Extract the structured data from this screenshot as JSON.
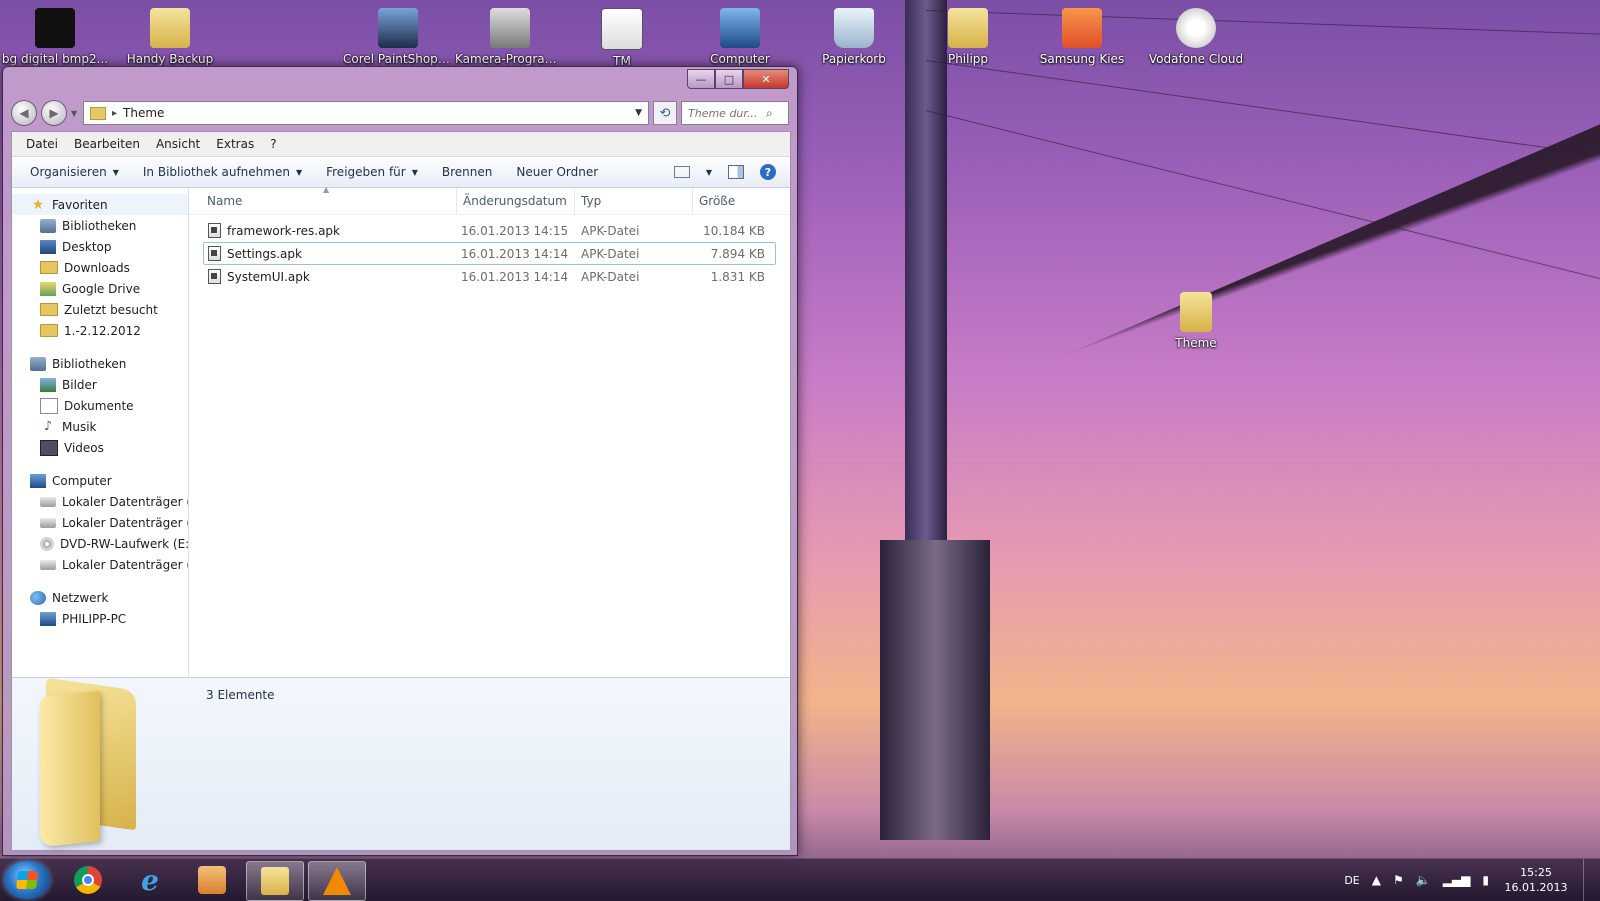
{
  "desktop": {
    "icons": [
      {
        "label": "bg digital bmp2...",
        "icon": "black-image-icon"
      },
      {
        "label": "Handy Backup",
        "icon": "backup-folder-icon"
      },
      {
        "label": "Corel PaintShop Pro",
        "icon": "camera-icon"
      },
      {
        "label": "Kamera-Programme",
        "icon": "camera-icon"
      },
      {
        "label": "TM",
        "icon": "app-icon"
      },
      {
        "label": "Computer",
        "icon": "computer-icon"
      },
      {
        "label": "Papierkorb",
        "icon": "recycle-bin-icon"
      },
      {
        "label": "Philipp",
        "icon": "user-folder-icon"
      },
      {
        "label": "Samsung Kies",
        "icon": "kies-icon"
      },
      {
        "label": "Vodafone Cloud",
        "icon": "cloud-icon"
      }
    ],
    "theme_icon": {
      "label": "Theme",
      "icon": "folder-icon"
    }
  },
  "window": {
    "caption_buttons": {
      "minimize": "—",
      "maximize": "□",
      "close": "✕"
    },
    "address": {
      "path": "Theme",
      "separator": "▸"
    },
    "search_placeholder": "Theme dur...",
    "menu": [
      "Datei",
      "Bearbeiten",
      "Ansicht",
      "Extras",
      "?"
    ],
    "commands": [
      "Organisieren",
      "In Bibliothek aufnehmen",
      "Freigeben für",
      "Brennen",
      "Neuer Ordner"
    ],
    "help_label": "?",
    "nav": {
      "favorites": {
        "label": "Favoriten",
        "items": [
          "Bibliotheken",
          "Desktop",
          "Downloads",
          "Google Drive",
          "Zuletzt besucht",
          "1.-2.12.2012"
        ]
      },
      "libraries": {
        "label": "Bibliotheken",
        "items": [
          "Bilder",
          "Dokumente",
          "Musik",
          "Videos"
        ]
      },
      "computer": {
        "label": "Computer",
        "items": [
          "Lokaler Datenträger (C:)",
          "Lokaler Datenträger (D:)",
          "DVD-RW-Laufwerk (E:) L",
          "Lokaler Datenträger (Q:)"
        ]
      },
      "network": {
        "label": "Netzwerk",
        "items": [
          "PHILIPP-PC"
        ]
      }
    },
    "columns": {
      "name": "Name",
      "date": "Änderungsdatum",
      "type": "Typ",
      "size": "Größe"
    },
    "files": [
      {
        "name": "framework-res.apk",
        "date": "16.01.2013 14:15",
        "type": "APK-Datei",
        "size": "10.184 KB"
      },
      {
        "name": "Settings.apk",
        "date": "16.01.2013 14:14",
        "type": "APK-Datei",
        "size": "7.894 KB"
      },
      {
        "name": "SystemUI.apk",
        "date": "16.01.2013 14:14",
        "type": "APK-Datei",
        "size": "1.831 KB"
      }
    ],
    "status": "3 Elemente"
  },
  "taskbar": {
    "apps": [
      "chrome-icon",
      "internet-explorer-icon",
      "media-player-icon",
      "explorer-icon",
      "vlc-icon"
    ],
    "lang": "DE",
    "time": "15:25",
    "date": "16.01.2013"
  }
}
